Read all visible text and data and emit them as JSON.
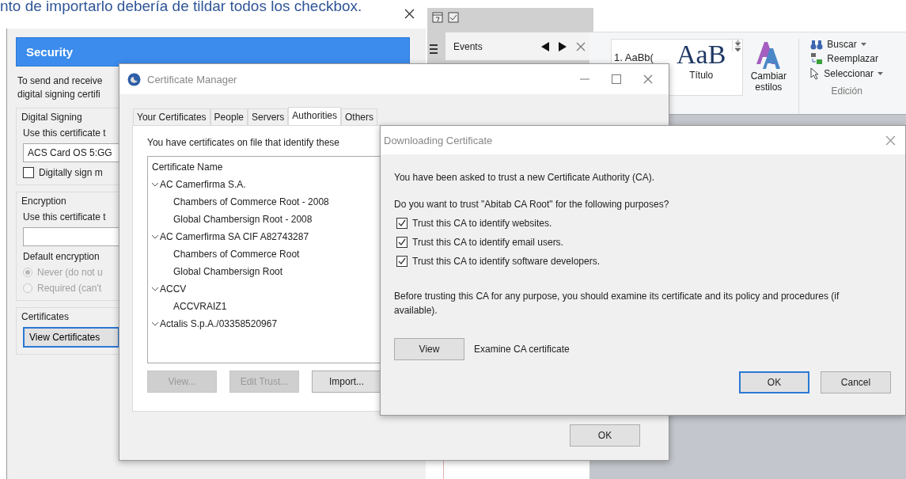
{
  "caption": "nto de importarlo debería de tildar todos los checkbox.",
  "account_settings": {
    "header": "Security",
    "intro": "To send and receive\ndigital signing certifi",
    "digital_signing": {
      "title": "Digital Signing",
      "label": "Use this certificate t",
      "value": "ACS Card OS 5:GG",
      "checkbox": {
        "label": "Digitally sign m",
        "checked": false
      }
    },
    "encryption": {
      "title": "Encryption",
      "label": "Use this certificate t",
      "default_label": "Default encryption",
      "options": [
        {
          "label": "Never (do not u",
          "selected": true,
          "disabled": true
        },
        {
          "label": "Required (can't",
          "selected": false,
          "disabled": true
        }
      ]
    },
    "certificates": {
      "title": "Certificates",
      "button": "View Certificates"
    }
  },
  "events_panel": {
    "title": "Events"
  },
  "ribbon": {
    "styles": [
      {
        "kind": "list",
        "preview": "1. AaBb("
      },
      {
        "kind": "heading",
        "preview": "AaB",
        "label": "Título"
      }
    ],
    "change_styles": "Cambiar estilos",
    "edit_group": {
      "title": "Edición",
      "items": [
        {
          "kind": "find",
          "label": "Buscar",
          "dropdown": true
        },
        {
          "kind": "replace",
          "label": "Reemplazar",
          "dropdown": false
        },
        {
          "kind": "select",
          "label": "Seleccionar",
          "dropdown": true
        }
      ]
    }
  },
  "certificate_manager": {
    "title": "Certificate Manager",
    "tabs": [
      {
        "label": "Your Certificates",
        "selected": false
      },
      {
        "label": "People",
        "selected": false
      },
      {
        "label": "Servers",
        "selected": false
      },
      {
        "label": "Authorities",
        "selected": true
      },
      {
        "label": "Others",
        "selected": false
      }
    ],
    "intro": "You have certificates on file that identify these",
    "columns": [
      "Certificate Name"
    ],
    "tree": [
      {
        "label": "AC Camerfirma S.A.",
        "expanded": true,
        "children": [
          {
            "label": "Chambers of Commerce Root - 2008"
          },
          {
            "label": "Global Chambersign Root - 2008"
          }
        ]
      },
      {
        "label": "AC Camerfirma SA CIF A82743287",
        "expanded": true,
        "children": [
          {
            "label": "Chambers of Commerce Root"
          },
          {
            "label": "Global Chambersign Root"
          }
        ]
      },
      {
        "label": "ACCV",
        "expanded": true,
        "children": [
          {
            "label": "ACCVRAIZ1"
          }
        ]
      },
      {
        "label": "Actalis S.p.A./03358520967",
        "expanded": true
      }
    ],
    "buttons": [
      {
        "label": "View...",
        "disabled": true
      },
      {
        "label": "Edit Trust...",
        "disabled": true
      },
      {
        "label": "Import...",
        "disabled": false
      }
    ],
    "ok": "OK"
  },
  "download_dialog": {
    "title": "Downloading Certificate",
    "message": "You have been asked to trust a new Certificate Authority (CA).",
    "question": "Do you want to trust \"Abitab CA Root\" for the following purposes?",
    "options": [
      {
        "label": "Trust this CA to identify websites.",
        "checked": true
      },
      {
        "label": "Trust this CA to identify email users.",
        "checked": true
      },
      {
        "label": "Trust this CA to identify software developers.",
        "checked": true
      }
    ],
    "note": "Before trusting this CA for any purpose, you should examine its certificate and its policy and procedures (if available).",
    "view_button": "View",
    "view_label": "Examine CA certificate",
    "buttons": [
      {
        "label": "OK",
        "default": true
      },
      {
        "label": "Cancel",
        "default": false
      }
    ]
  }
}
